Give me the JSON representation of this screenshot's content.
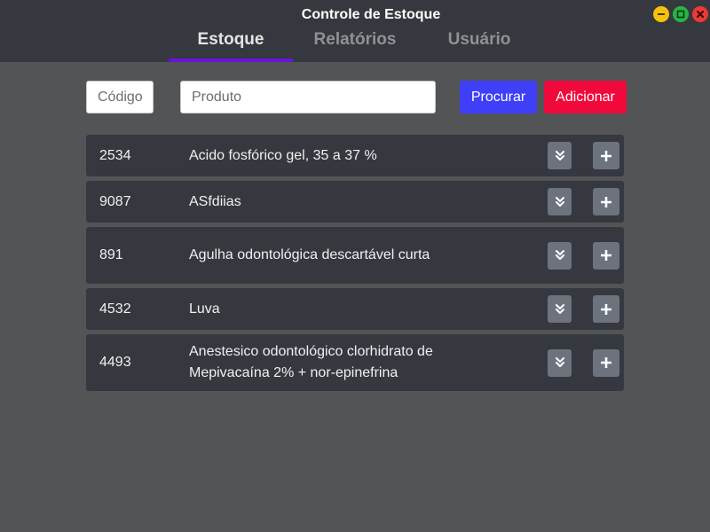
{
  "window": {
    "title": "Controle de Estoque",
    "controls": [
      {
        "name": "minimize-icon",
        "color": "#f4c20d"
      },
      {
        "name": "maximize-icon",
        "color": "#28b446"
      },
      {
        "name": "close-icon",
        "color": "#ea3a35"
      }
    ]
  },
  "tabs": [
    {
      "label": "Estoque",
      "active": true
    },
    {
      "label": "Relatórios",
      "active": false
    },
    {
      "label": "Usuário",
      "active": false
    }
  ],
  "search": {
    "code_placeholder": "Código",
    "product_placeholder": "Produto",
    "search_label": "Procurar",
    "add_label": "Adicionar"
  },
  "colors": {
    "accent_tab": "#6b12e0",
    "search_button": "#3f3ff8",
    "add_button": "#f00a3c",
    "row_bg": "#35383e",
    "page_bg": "#535456"
  },
  "products": [
    {
      "code": "2534",
      "name": "Acido fosfórico gel, 35 a 37 %"
    },
    {
      "code": "9087",
      "name": "ASfdiias"
    },
    {
      "code": "891",
      "name": "Agulha odontológica descartável curta"
    },
    {
      "code": "4532",
      "name": "Luva"
    },
    {
      "code": "4493",
      "name": "Anestesico odontológico clorhidrato de Mepivacaína 2% + nor-epinefrina"
    }
  ],
  "row_icons": {
    "expand": "double-chevron-down-icon",
    "add": "plus-icon"
  }
}
